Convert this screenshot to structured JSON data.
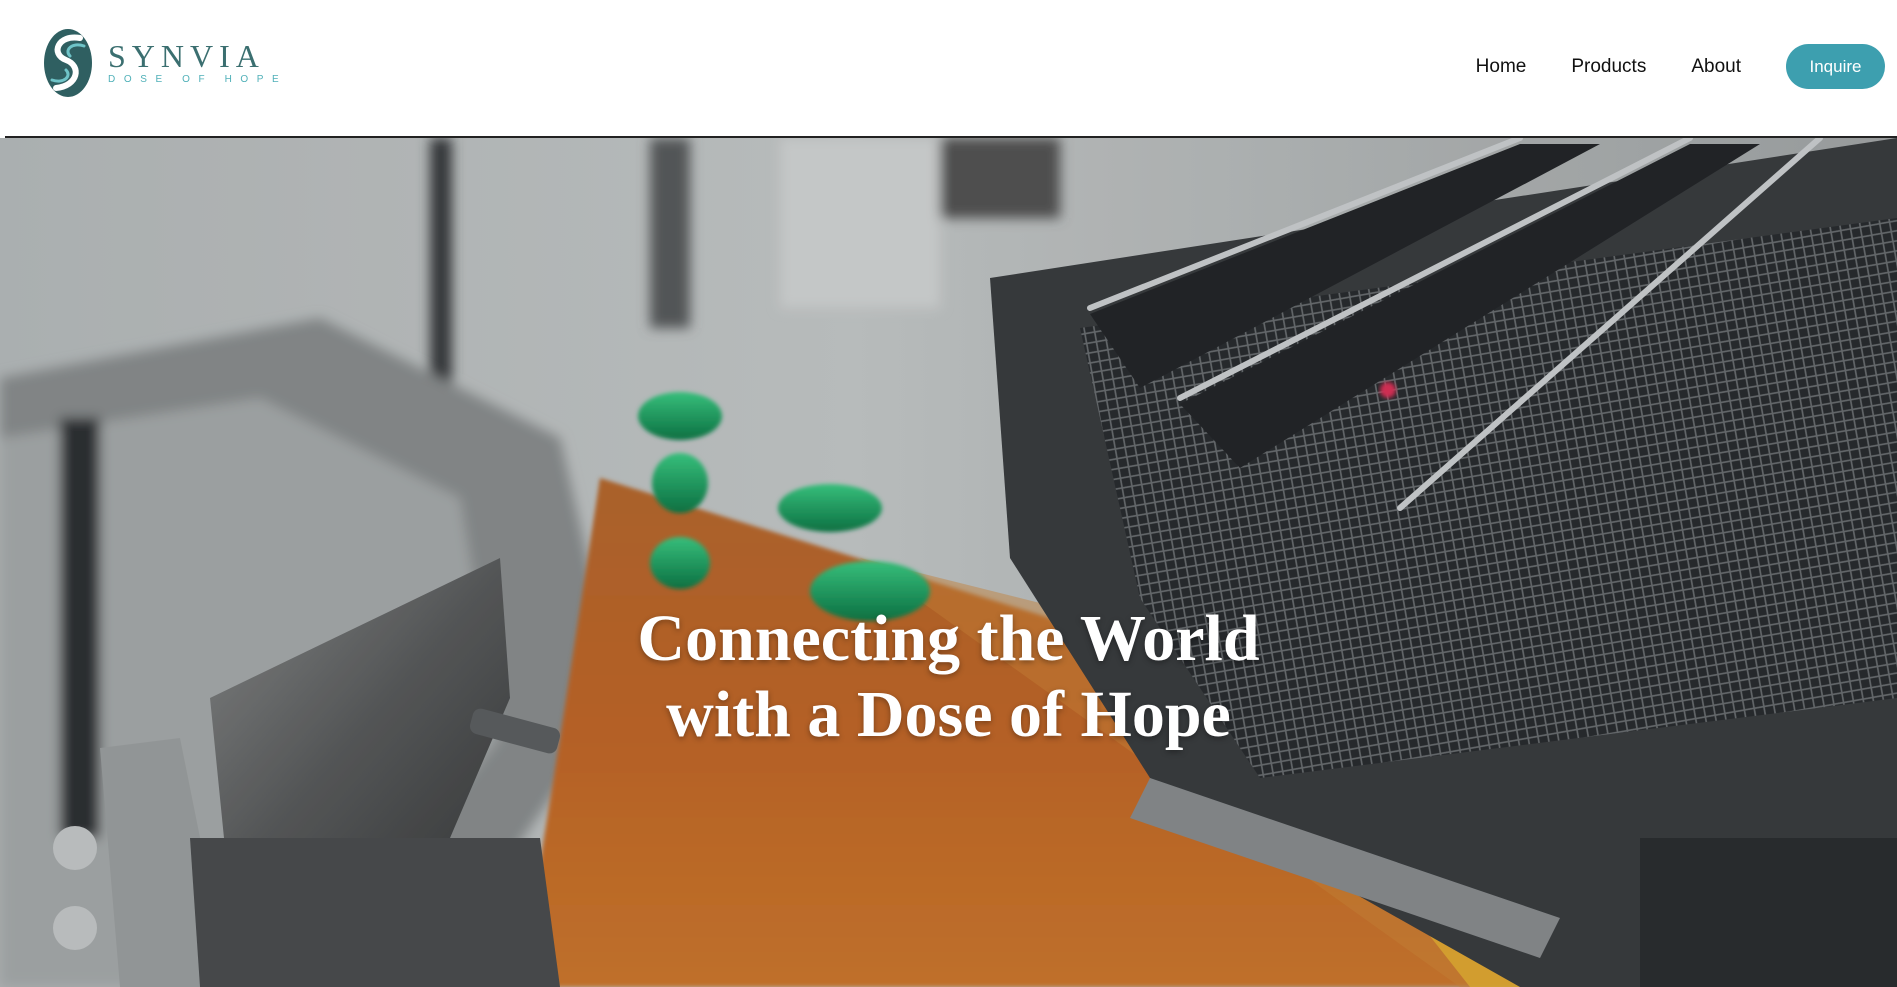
{
  "brand": {
    "name": "SYNVIA",
    "tagline": "DOSE OF HOPE",
    "logo_icon": "synvia-s-swirl-logo",
    "colors": {
      "primary": "#3b6f70",
      "accent": "#4fb0b8"
    }
  },
  "nav": {
    "items": [
      {
        "label": "Home"
      },
      {
        "label": "Products"
      },
      {
        "label": "About"
      }
    ],
    "cta_label": "Inquire",
    "cta_color": "#3d9faf"
  },
  "hero": {
    "title_line1": "Connecting the World",
    "title_line2": "with a Dose of Hope",
    "background": "pharmaceutical capsule conveyor belt video frame"
  }
}
